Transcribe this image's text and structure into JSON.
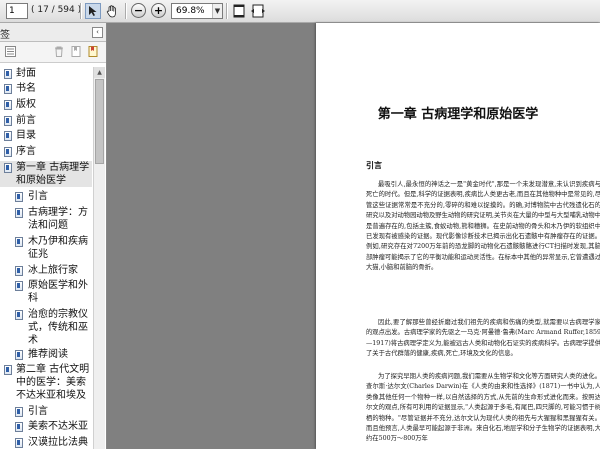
{
  "toolbar": {
    "current_page": "1",
    "page_count": "( 17 / 594 )",
    "zoom": "69.8%",
    "icons": [
      "select-arrow-icon",
      "hand-icon",
      "zoom-out-icon",
      "zoom-in-icon",
      "fit-page-icon",
      "fit-width-icon"
    ]
  },
  "sidebar": {
    "title": "签",
    "bookmarks": [
      {
        "label": "封面"
      },
      {
        "label": "书名"
      },
      {
        "label": "版权"
      },
      {
        "label": "前言"
      },
      {
        "label": "目录"
      },
      {
        "label": "序言"
      },
      {
        "label": "第一章  古病理学和原始医学",
        "expanded": true,
        "selected": true
      },
      {
        "label": "引言"
      },
      {
        "label": "古病理学：方法和问题"
      },
      {
        "label": "木乃伊和疾病征兆"
      },
      {
        "label": "冰上旅行家"
      },
      {
        "label": "原始医学和外科"
      },
      {
        "label": "治愈的宗教仪式，传统和巫术"
      },
      {
        "label": "推荐阅读"
      },
      {
        "label": "第二章  古代文明中的医学：美索不达米亚和埃及",
        "expanded": true
      },
      {
        "label": "引言"
      },
      {
        "label": "美索不达米亚"
      },
      {
        "label": "汉谟拉比法典"
      }
    ]
  },
  "document": {
    "chapter_title": "第一章   古病理学和原始医学",
    "section_title": "引言",
    "paragraphs": [
      "最吸引人,最永恒的神话之一是\"黄金时代\",那是一个未发现潜意,未认识到疾病与死亡的时代。但是,科学的证据表明,疾病比人类更古老,而且在其他物种中是常见的,尽管这些证据常常是不充分的,零碎的和难以捉摸的。的确,对博物院中古代残遗化石的研究以及对动物园动物及野生动物的研究证明,关节炎在大量的中型与大型哺乳动物中是普遍存在的,包括主簇,食蚁动物,熊和穗狮。在史前动物的骨头和木乃伊的软组织中已发现有被感染的证据。现代影像诊断技术已揭示出化石遗骸中有肿瘤存在的证据。例如,研究存在对7200万年前的恐龙脚的动物化石遗骸骸骼进行CT扫描时发现,其脑部肿瘤可能揭示了它的平衡功能和运动灵活性。在标本中其他的异常显示,它曾遭遇过大猫,小脑和前脑的骨折。",
      "因此,要了解那些曾经折磨过我们祖先的疾病和伤痛的类型,就需要以古病理学家的观点出发。古病理学家的先驱之一马克·阿曼德·鲁弗(Marc Armand Ruffer,1859—1917)将古病理学定义为,能被远古人类和动物化石证实的疾病科学。古病理学提供了关于古代群落的健康,疾病,死亡,环境及文化的信息。",
      "为了探究早期人类的疾病问题,我们需要从生物学和文化等方面研究人类的进化。查尔斯·达尔文(Charles Darwin)在《人类的由来和性选择》(1871)一书中认为,人类像其他任何一个物种一样,以自然选择的方式,从先前的生命形式进化而来。按照达尔文的观点,所有可利用的证据显示,\"人类起源于多毛,有尾巴,四只脚的,可能习惯于树栖的物种。\"尽管证据并不充分,达尔文认为现代人类的祖先与大猩猩和黑猩猩有关。而且他预言,人类最早可能起源于非洲。来自化石,地层学和分子生物学的证据表明,大约在500万～800万年"
    ]
  }
}
